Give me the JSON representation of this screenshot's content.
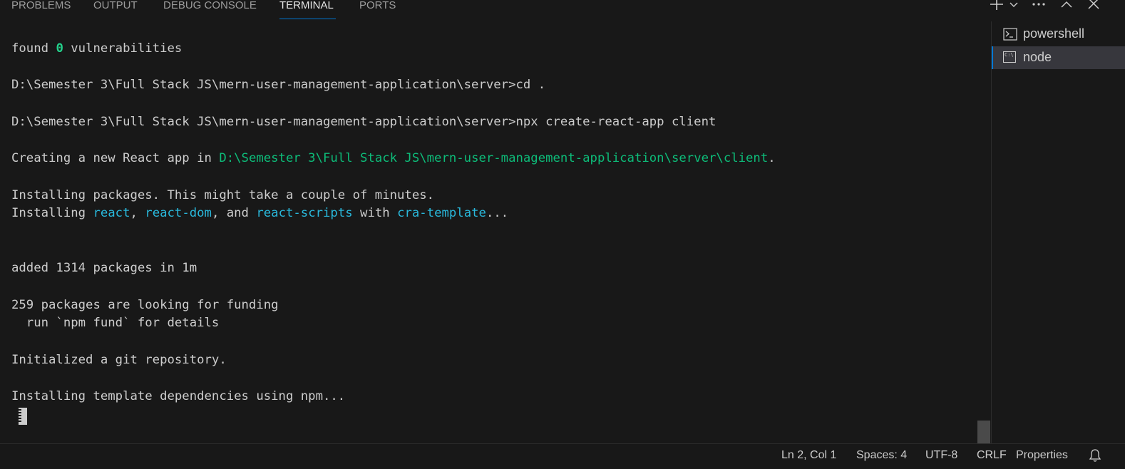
{
  "tabs": [
    {
      "label": "PROBLEMS",
      "active": false
    },
    {
      "label": "OUTPUT",
      "active": false
    },
    {
      "label": "DEBUG CONSOLE",
      "active": false
    },
    {
      "label": "TERMINAL",
      "active": true
    },
    {
      "label": "PORTS",
      "active": false
    }
  ],
  "toolbar": {
    "icons": [
      "add-icon",
      "chevron-down-icon",
      "more-icon",
      "chevron-up-icon",
      "close-icon"
    ]
  },
  "terminal": {
    "lines": [
      {
        "segments": [
          {
            "t": "found ",
            "c": "plain"
          },
          {
            "t": "0",
            "c": "green"
          },
          {
            "t": " vulnerabilities",
            "c": "plain"
          }
        ]
      },
      {
        "segments": []
      },
      {
        "segments": [
          {
            "t": "D:\\Semester 3\\Full Stack JS\\mern-user-management-application\\server>cd .",
            "c": "plain"
          }
        ]
      },
      {
        "segments": []
      },
      {
        "segments": [
          {
            "t": "D:\\Semester 3\\Full Stack JS\\mern-user-management-application\\server>npx create-react-app client",
            "c": "plain"
          }
        ]
      },
      {
        "segments": []
      },
      {
        "segments": [
          {
            "t": "Creating a new React app in ",
            "c": "plain"
          },
          {
            "t": "D:\\Semester 3\\Full Stack JS\\mern-user-management-application\\server\\client",
            "c": "path"
          },
          {
            "t": ".",
            "c": "plain"
          }
        ]
      },
      {
        "segments": []
      },
      {
        "segments": [
          {
            "t": "Installing packages. This might take a couple of minutes.",
            "c": "plain"
          }
        ]
      },
      {
        "segments": [
          {
            "t": "Installing ",
            "c": "plain"
          },
          {
            "t": "react",
            "c": "cyan"
          },
          {
            "t": ", ",
            "c": "plain"
          },
          {
            "t": "react-dom",
            "c": "cyan"
          },
          {
            "t": ", and ",
            "c": "plain"
          },
          {
            "t": "react-scripts",
            "c": "cyan"
          },
          {
            "t": " with ",
            "c": "plain"
          },
          {
            "t": "cra-template",
            "c": "cyan"
          },
          {
            "t": "...",
            "c": "plain"
          }
        ]
      },
      {
        "segments": []
      },
      {
        "segments": []
      },
      {
        "segments": [
          {
            "t": "added 1314 packages in 1m",
            "c": "plain"
          }
        ]
      },
      {
        "segments": []
      },
      {
        "segments": [
          {
            "t": "259 packages are looking for funding",
            "c": "plain"
          }
        ]
      },
      {
        "segments": [
          {
            "t": "  run `npm fund` for details",
            "c": "plain"
          }
        ]
      },
      {
        "segments": []
      },
      {
        "segments": [
          {
            "t": "Initialized a git repository.",
            "c": "plain"
          }
        ]
      },
      {
        "segments": []
      },
      {
        "segments": [
          {
            "t": "Installing template dependencies using npm...",
            "c": "plain"
          }
        ]
      }
    ]
  },
  "terminal_list": [
    {
      "label": "powershell",
      "icon": "powershell-icon",
      "active": false
    },
    {
      "label": "node",
      "icon": "cmd-icon",
      "icon_text": "C:\\",
      "active": true
    }
  ],
  "statusbar": {
    "position": "Ln 2, Col 1",
    "spaces": "Spaces: 4",
    "encoding": "UTF-8",
    "eol": "CRLF",
    "language": "Properties",
    "bell_icon": "bell-icon"
  },
  "colors": {
    "background": "#181818",
    "accent": "#0078d4",
    "text": "#cccccc",
    "green": "#23d18b",
    "cyan": "#29b8db"
  }
}
